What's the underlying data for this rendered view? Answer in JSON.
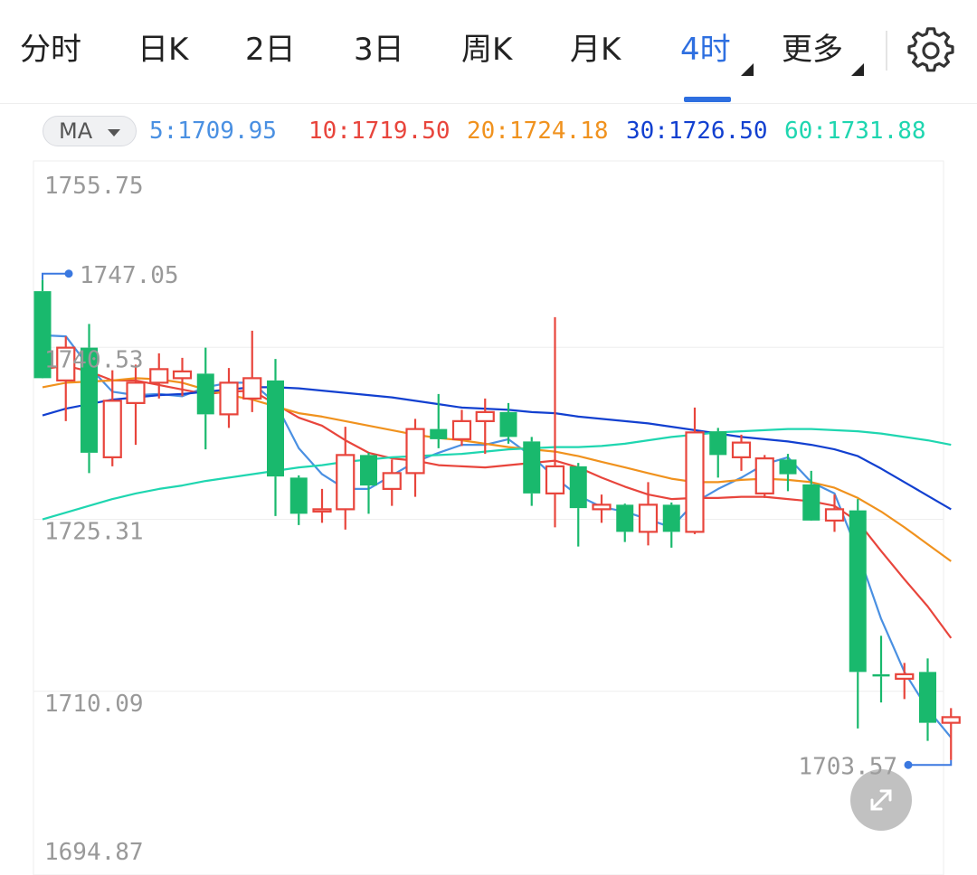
{
  "tabs": [
    {
      "label": "分时",
      "active": false
    },
    {
      "label": "日K",
      "active": false
    },
    {
      "label": "2日",
      "active": false
    },
    {
      "label": "3日",
      "active": false
    },
    {
      "label": "周K",
      "active": false
    },
    {
      "label": "月K",
      "active": false
    },
    {
      "label": "4时",
      "active": true
    },
    {
      "label": "更多",
      "active": false
    }
  ],
  "ma_selector": "MA",
  "ma_values": [
    {
      "label": "5:1709.95",
      "color": "#4a90e2"
    },
    {
      "label": "10:1719.50",
      "color": "#e8453c"
    },
    {
      "label": "20:1724.18",
      "color": "#f0921e"
    },
    {
      "label": "30:1726.50",
      "color": "#1240d0"
    },
    {
      "label": "60:1731.88",
      "color": "#1fd6b0"
    }
  ],
  "colors": {
    "up": "#e8453c",
    "down": "#19b96d",
    "accent": "#2e6fe0",
    "grid": "#eeeeee",
    "axis_text": "#999999"
  },
  "icons": {
    "settings": "gear-icon",
    "zoom": "expand-icon"
  },
  "chart_data": {
    "type": "candlestick",
    "y_axis_labels": [
      "1755.75",
      "1740.53",
      "1725.31",
      "1710.09",
      "1694.87"
    ],
    "ylim": [
      1694.87,
      1755.75
    ],
    "max_marker": "1747.05",
    "min_marker": "1703.57",
    "candles": [
      {
        "o": 1745.5,
        "h": 1746.5,
        "l": 1738.2,
        "c": 1737.8
      },
      {
        "o": 1737.6,
        "h": 1741.5,
        "l": 1734.0,
        "c": 1740.5
      },
      {
        "o": 1740.5,
        "h": 1742.6,
        "l": 1729.4,
        "c": 1731.2
      },
      {
        "o": 1730.8,
        "h": 1738.5,
        "l": 1730.0,
        "c": 1735.8
      },
      {
        "o": 1735.6,
        "h": 1739.0,
        "l": 1731.9,
        "c": 1737.4
      },
      {
        "o": 1737.4,
        "h": 1740.0,
        "l": 1736.0,
        "c": 1738.6
      },
      {
        "o": 1737.8,
        "h": 1739.6,
        "l": 1736.2,
        "c": 1738.4
      },
      {
        "o": 1738.2,
        "h": 1740.5,
        "l": 1731.5,
        "c": 1734.6
      },
      {
        "o": 1734.6,
        "h": 1738.7,
        "l": 1733.4,
        "c": 1737.4
      },
      {
        "o": 1736.0,
        "h": 1742.0,
        "l": 1734.8,
        "c": 1737.8
      },
      {
        "o": 1737.6,
        "h": 1739.5,
        "l": 1725.6,
        "c": 1729.1
      },
      {
        "o": 1729.0,
        "h": 1729.2,
        "l": 1724.8,
        "c": 1725.8
      },
      {
        "o": 1726.0,
        "h": 1728.0,
        "l": 1725.0,
        "c": 1726.2
      },
      {
        "o": 1726.2,
        "h": 1733.5,
        "l": 1724.4,
        "c": 1731.0
      },
      {
        "o": 1731.0,
        "h": 1731.2,
        "l": 1725.8,
        "c": 1728.3
      },
      {
        "o": 1728.0,
        "h": 1730.6,
        "l": 1726.5,
        "c": 1729.4
      },
      {
        "o": 1729.4,
        "h": 1734.2,
        "l": 1727.3,
        "c": 1733.3
      },
      {
        "o": 1733.3,
        "h": 1736.4,
        "l": 1731.6,
        "c": 1732.4
      },
      {
        "o": 1732.4,
        "h": 1735.0,
        "l": 1731.8,
        "c": 1734.0
      },
      {
        "o": 1734.0,
        "h": 1736.0,
        "l": 1731.1,
        "c": 1734.8
      },
      {
        "o": 1734.8,
        "h": 1735.6,
        "l": 1732.0,
        "c": 1732.6
      },
      {
        "o": 1732.2,
        "h": 1732.6,
        "l": 1726.5,
        "c": 1727.6
      },
      {
        "o": 1727.6,
        "h": 1743.2,
        "l": 1724.6,
        "c": 1730.0
      },
      {
        "o": 1730.0,
        "h": 1730.3,
        "l": 1722.9,
        "c": 1726.3
      },
      {
        "o": 1726.2,
        "h": 1727.5,
        "l": 1725.0,
        "c": 1726.6
      },
      {
        "o": 1726.6,
        "h": 1726.7,
        "l": 1723.3,
        "c": 1724.2
      },
      {
        "o": 1724.2,
        "h": 1728.6,
        "l": 1723.0,
        "c": 1726.6
      },
      {
        "o": 1726.6,
        "h": 1726.8,
        "l": 1722.8,
        "c": 1724.2
      },
      {
        "o": 1724.2,
        "h": 1735.2,
        "l": 1724.0,
        "c": 1733.0
      },
      {
        "o": 1733.1,
        "h": 1733.4,
        "l": 1729.0,
        "c": 1731.0
      },
      {
        "o": 1730.8,
        "h": 1732.8,
        "l": 1729.6,
        "c": 1732.1
      },
      {
        "o": 1727.6,
        "h": 1731.0,
        "l": 1727.2,
        "c": 1730.7
      },
      {
        "o": 1730.6,
        "h": 1731.1,
        "l": 1727.8,
        "c": 1729.3
      },
      {
        "o": 1728.4,
        "h": 1729.6,
        "l": 1725.3,
        "c": 1725.2
      },
      {
        "o": 1725.2,
        "h": 1727.5,
        "l": 1724.2,
        "c": 1726.2
      },
      {
        "o": 1726.1,
        "h": 1727.1,
        "l": 1706.8,
        "c": 1711.8
      },
      {
        "o": 1711.6,
        "h": 1715.0,
        "l": 1709.1,
        "c": 1711.4
      },
      {
        "o": 1711.2,
        "h": 1712.6,
        "l": 1709.4,
        "c": 1711.6
      },
      {
        "o": 1711.8,
        "h": 1713.0,
        "l": 1705.7,
        "c": 1707.3
      },
      {
        "o": 1707.3,
        "h": 1708.6,
        "l": 1704.0,
        "c": 1707.8
      }
    ],
    "ma_lines": [
      {
        "name": "5",
        "color": "#4a90e2",
        "points": [
          [
            0,
            1741.6
          ],
          [
            1,
            1741.5
          ],
          [
            2,
            1738.8
          ],
          [
            3,
            1736.6
          ],
          [
            4,
            1736.3
          ],
          [
            5,
            1736.4
          ],
          [
            6,
            1736.2
          ],
          [
            7,
            1737.0
          ],
          [
            8,
            1737.4
          ],
          [
            9,
            1737.4
          ],
          [
            10,
            1735.6
          ],
          [
            11,
            1731.6
          ],
          [
            12,
            1729.3
          ],
          [
            13,
            1728.0
          ],
          [
            14,
            1728.0
          ],
          [
            15,
            1729.2
          ],
          [
            16,
            1730.4
          ],
          [
            17,
            1731.2
          ],
          [
            18,
            1731.9
          ],
          [
            19,
            1731.9
          ],
          [
            20,
            1732.4
          ],
          [
            21,
            1730.9
          ],
          [
            22,
            1729.0
          ],
          [
            23,
            1727.4
          ],
          [
            24,
            1726.4
          ],
          [
            25,
            1726.0
          ],
          [
            26,
            1725.3
          ],
          [
            27,
            1724.6
          ],
          [
            28,
            1726.8
          ],
          [
            29,
            1728.0
          ],
          [
            30,
            1729.0
          ],
          [
            31,
            1730.2
          ],
          [
            32,
            1730.8
          ],
          [
            33,
            1728.6
          ],
          [
            34,
            1727.6
          ],
          [
            35,
            1722.4
          ],
          [
            36,
            1716.5
          ],
          [
            37,
            1711.8
          ],
          [
            38,
            1708.5
          ],
          [
            39,
            1706.0
          ]
        ]
      },
      {
        "name": "10",
        "color": "#e8453c",
        "points": [
          [
            0,
            1738.6
          ],
          [
            1,
            1738.9
          ],
          [
            2,
            1738.4
          ],
          [
            3,
            1737.6
          ],
          [
            4,
            1737.6
          ],
          [
            5,
            1737.2
          ],
          [
            6,
            1736.8
          ],
          [
            7,
            1736.4
          ],
          [
            8,
            1736.6
          ],
          [
            9,
            1736.7
          ],
          [
            10,
            1735.5
          ],
          [
            11,
            1734.3
          ],
          [
            12,
            1733.6
          ],
          [
            13,
            1732.3
          ],
          [
            14,
            1731.2
          ],
          [
            15,
            1730.7
          ],
          [
            16,
            1730.5
          ],
          [
            17,
            1730.1
          ],
          [
            18,
            1730.0
          ],
          [
            19,
            1729.9
          ],
          [
            20,
            1730.1
          ],
          [
            21,
            1730.3
          ],
          [
            22,
            1730.5
          ],
          [
            23,
            1729.9
          ],
          [
            24,
            1729.0
          ],
          [
            25,
            1728.2
          ],
          [
            26,
            1727.5
          ],
          [
            27,
            1727.1
          ],
          [
            28,
            1727.2
          ],
          [
            29,
            1727.2
          ],
          [
            30,
            1727.3
          ],
          [
            31,
            1727.3
          ],
          [
            32,
            1727.1
          ],
          [
            33,
            1726.9
          ],
          [
            34,
            1726.5
          ],
          [
            35,
            1725.1
          ],
          [
            36,
            1722.5
          ],
          [
            37,
            1720.0
          ],
          [
            38,
            1717.6
          ],
          [
            39,
            1714.8
          ]
        ]
      },
      {
        "name": "20",
        "color": "#f0921e",
        "points": [
          [
            0,
            1737.0
          ],
          [
            1,
            1737.4
          ],
          [
            2,
            1737.5
          ],
          [
            3,
            1737.6
          ],
          [
            4,
            1737.8
          ],
          [
            5,
            1737.7
          ],
          [
            6,
            1737.4
          ],
          [
            7,
            1736.8
          ],
          [
            8,
            1736.3
          ],
          [
            9,
            1735.9
          ],
          [
            10,
            1735.3
          ],
          [
            11,
            1734.7
          ],
          [
            12,
            1734.4
          ],
          [
            13,
            1734.0
          ],
          [
            14,
            1733.6
          ],
          [
            15,
            1733.2
          ],
          [
            16,
            1732.8
          ],
          [
            17,
            1732.5
          ],
          [
            18,
            1732.3
          ],
          [
            19,
            1732.0
          ],
          [
            20,
            1731.7
          ],
          [
            21,
            1731.5
          ],
          [
            22,
            1731.3
          ],
          [
            23,
            1730.9
          ],
          [
            24,
            1730.4
          ],
          [
            25,
            1729.9
          ],
          [
            26,
            1729.4
          ],
          [
            27,
            1728.9
          ],
          [
            28,
            1728.6
          ],
          [
            29,
            1728.6
          ],
          [
            30,
            1728.8
          ],
          [
            31,
            1728.9
          ],
          [
            32,
            1728.8
          ],
          [
            33,
            1728.6
          ],
          [
            34,
            1728.1
          ],
          [
            35,
            1727.2
          ],
          [
            36,
            1726.0
          ],
          [
            37,
            1724.6
          ],
          [
            38,
            1723.1
          ],
          [
            39,
            1721.6
          ]
        ]
      },
      {
        "name": "30",
        "color": "#1240d0",
        "points": [
          [
            0,
            1734.5
          ],
          [
            1,
            1735.1
          ],
          [
            2,
            1735.5
          ],
          [
            3,
            1735.9
          ],
          [
            4,
            1736.1
          ],
          [
            5,
            1736.3
          ],
          [
            6,
            1736.4
          ],
          [
            7,
            1736.6
          ],
          [
            8,
            1736.8
          ],
          [
            9,
            1737.0
          ],
          [
            10,
            1737.0
          ],
          [
            11,
            1736.9
          ],
          [
            12,
            1736.7
          ],
          [
            13,
            1736.5
          ],
          [
            14,
            1736.3
          ],
          [
            15,
            1736.1
          ],
          [
            16,
            1735.8
          ],
          [
            17,
            1735.5
          ],
          [
            18,
            1735.2
          ],
          [
            19,
            1735.1
          ],
          [
            20,
            1735.0
          ],
          [
            21,
            1734.8
          ],
          [
            22,
            1734.7
          ],
          [
            23,
            1734.4
          ],
          [
            24,
            1734.2
          ],
          [
            25,
            1734.0
          ],
          [
            26,
            1733.8
          ],
          [
            27,
            1733.5
          ],
          [
            28,
            1733.2
          ],
          [
            29,
            1732.9
          ],
          [
            30,
            1732.6
          ],
          [
            31,
            1732.4
          ],
          [
            32,
            1732.2
          ],
          [
            33,
            1731.9
          ],
          [
            34,
            1731.5
          ],
          [
            35,
            1730.9
          ],
          [
            36,
            1729.8
          ],
          [
            37,
            1728.6
          ],
          [
            38,
            1727.4
          ],
          [
            39,
            1726.2
          ]
        ]
      },
      {
        "name": "60",
        "color": "#1fd6b0",
        "points": [
          [
            0,
            1725.3
          ],
          [
            1,
            1725.9
          ],
          [
            2,
            1726.5
          ],
          [
            3,
            1727.1
          ],
          [
            4,
            1727.6
          ],
          [
            5,
            1728.0
          ],
          [
            6,
            1728.3
          ],
          [
            7,
            1728.7
          ],
          [
            8,
            1729.0
          ],
          [
            9,
            1729.3
          ],
          [
            10,
            1729.6
          ],
          [
            11,
            1729.9
          ],
          [
            12,
            1730.1
          ],
          [
            13,
            1730.4
          ],
          [
            14,
            1730.6
          ],
          [
            15,
            1730.8
          ],
          [
            16,
            1730.9
          ],
          [
            17,
            1731.0
          ],
          [
            18,
            1731.1
          ],
          [
            19,
            1731.3
          ],
          [
            20,
            1731.5
          ],
          [
            21,
            1731.6
          ],
          [
            22,
            1731.7
          ],
          [
            23,
            1731.7
          ],
          [
            24,
            1731.8
          ],
          [
            25,
            1732.0
          ],
          [
            26,
            1732.3
          ],
          [
            27,
            1732.6
          ],
          [
            28,
            1732.8
          ],
          [
            29,
            1733.0
          ],
          [
            30,
            1733.1
          ],
          [
            31,
            1733.2
          ],
          [
            32,
            1733.3
          ],
          [
            33,
            1733.3
          ],
          [
            34,
            1733.2
          ],
          [
            35,
            1733.1
          ],
          [
            36,
            1732.9
          ],
          [
            37,
            1732.6
          ],
          [
            38,
            1732.3
          ],
          [
            39,
            1731.9
          ]
        ]
      }
    ]
  }
}
